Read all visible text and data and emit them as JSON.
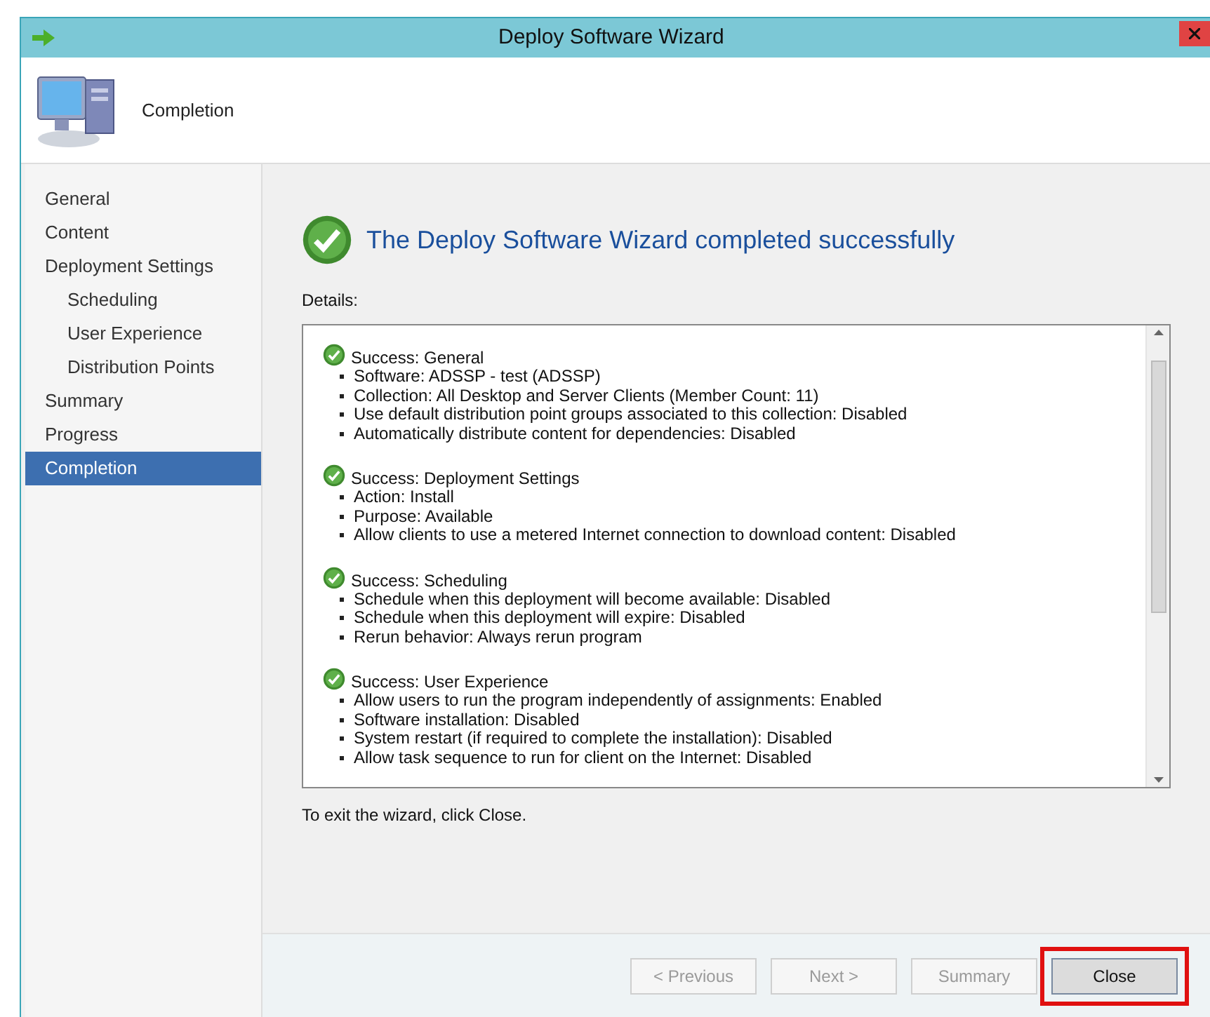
{
  "window": {
    "title": "Deploy Software Wizard"
  },
  "header": {
    "title": "Completion"
  },
  "sidebar": {
    "items": [
      {
        "label": "General",
        "selected": false
      },
      {
        "label": "Content",
        "selected": false
      },
      {
        "label": "Deployment Settings",
        "selected": false,
        "children": [
          {
            "label": "Scheduling",
            "selected": false
          },
          {
            "label": "User Experience",
            "selected": false
          },
          {
            "label": "Distribution Points",
            "selected": false
          }
        ]
      },
      {
        "label": "Summary",
        "selected": false
      },
      {
        "label": "Progress",
        "selected": false
      },
      {
        "label": "Completion",
        "selected": true
      }
    ]
  },
  "result": {
    "message": "The Deploy Software Wizard completed successfully"
  },
  "details_label": "Details:",
  "details": [
    {
      "title": "Success: General",
      "items": [
        "Software: ADSSP - test (ADSSP)",
        "Collection: All Desktop and Server Clients (Member Count: 11)",
        "Use default distribution point groups associated to this collection: Disabled",
        "Automatically distribute content for dependencies: Disabled"
      ]
    },
    {
      "title": "Success: Deployment Settings",
      "items": [
        "Action: Install",
        "Purpose: Available",
        "Allow clients to use a metered Internet connection to download content: Disabled"
      ]
    },
    {
      "title": "Success: Scheduling",
      "items": [
        "Schedule when this deployment will become available: Disabled",
        "Schedule when this deployment will expire: Disabled",
        "Rerun behavior: Always rerun program"
      ]
    },
    {
      "title": "Success: User Experience",
      "items": [
        "Allow users to run the program independently of assignments: Enabled",
        "Software installation: Disabled",
        "System restart (if required to complete the installation): Disabled",
        "Allow task sequence to run for client on the Internet: Disabled"
      ]
    }
  ],
  "footer_note": "To exit the wizard, click Close.",
  "buttons": [
    {
      "label": "< Previous",
      "disabled": true,
      "highlighted": false
    },
    {
      "label": "Next >",
      "disabled": true,
      "highlighted": false
    },
    {
      "label": "Summary",
      "disabled": true,
      "highlighted": false
    },
    {
      "label": "Close",
      "disabled": false,
      "highlighted": true
    }
  ]
}
